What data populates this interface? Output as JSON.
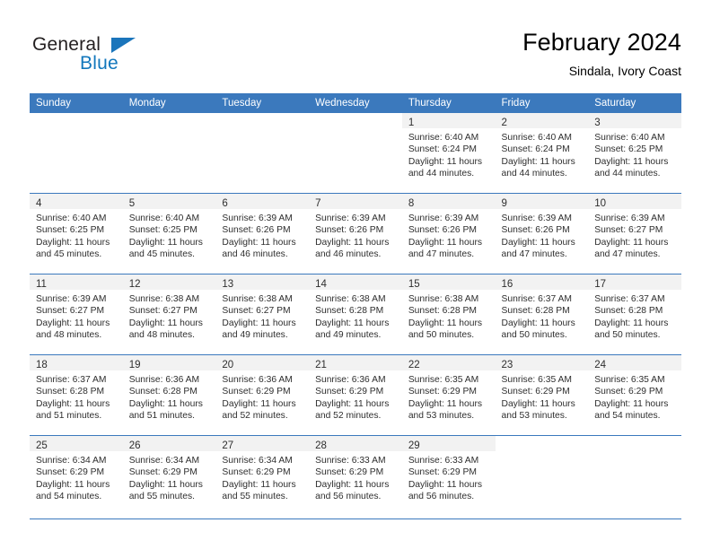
{
  "brand": {
    "name_part1": "General",
    "name_part2": "Blue"
  },
  "header": {
    "title": "February 2024",
    "subtitle": "Sindala, Ivory Coast"
  },
  "weekday_headers": [
    "Sunday",
    "Monday",
    "Tuesday",
    "Wednesday",
    "Thursday",
    "Friday",
    "Saturday"
  ],
  "colors": {
    "header_blue": "#3b79bd",
    "daynum_band": "#f2f2f2",
    "logo_blue": "#1b75bb",
    "text": "#2e2e2e"
  },
  "weeks": [
    [
      {
        "day": "",
        "sunrise": "",
        "sunset": "",
        "daylight_line1": "",
        "daylight_line2": ""
      },
      {
        "day": "",
        "sunrise": "",
        "sunset": "",
        "daylight_line1": "",
        "daylight_line2": ""
      },
      {
        "day": "",
        "sunrise": "",
        "sunset": "",
        "daylight_line1": "",
        "daylight_line2": ""
      },
      {
        "day": "",
        "sunrise": "",
        "sunset": "",
        "daylight_line1": "",
        "daylight_line2": ""
      },
      {
        "day": "1",
        "sunrise": "Sunrise: 6:40 AM",
        "sunset": "Sunset: 6:24 PM",
        "daylight_line1": "Daylight: 11 hours",
        "daylight_line2": "and 44 minutes."
      },
      {
        "day": "2",
        "sunrise": "Sunrise: 6:40 AM",
        "sunset": "Sunset: 6:24 PM",
        "daylight_line1": "Daylight: 11 hours",
        "daylight_line2": "and 44 minutes."
      },
      {
        "day": "3",
        "sunrise": "Sunrise: 6:40 AM",
        "sunset": "Sunset: 6:25 PM",
        "daylight_line1": "Daylight: 11 hours",
        "daylight_line2": "and 44 minutes."
      }
    ],
    [
      {
        "day": "4",
        "sunrise": "Sunrise: 6:40 AM",
        "sunset": "Sunset: 6:25 PM",
        "daylight_line1": "Daylight: 11 hours",
        "daylight_line2": "and 45 minutes."
      },
      {
        "day": "5",
        "sunrise": "Sunrise: 6:40 AM",
        "sunset": "Sunset: 6:25 PM",
        "daylight_line1": "Daylight: 11 hours",
        "daylight_line2": "and 45 minutes."
      },
      {
        "day": "6",
        "sunrise": "Sunrise: 6:39 AM",
        "sunset": "Sunset: 6:26 PM",
        "daylight_line1": "Daylight: 11 hours",
        "daylight_line2": "and 46 minutes."
      },
      {
        "day": "7",
        "sunrise": "Sunrise: 6:39 AM",
        "sunset": "Sunset: 6:26 PM",
        "daylight_line1": "Daylight: 11 hours",
        "daylight_line2": "and 46 minutes."
      },
      {
        "day": "8",
        "sunrise": "Sunrise: 6:39 AM",
        "sunset": "Sunset: 6:26 PM",
        "daylight_line1": "Daylight: 11 hours",
        "daylight_line2": "and 47 minutes."
      },
      {
        "day": "9",
        "sunrise": "Sunrise: 6:39 AM",
        "sunset": "Sunset: 6:26 PM",
        "daylight_line1": "Daylight: 11 hours",
        "daylight_line2": "and 47 minutes."
      },
      {
        "day": "10",
        "sunrise": "Sunrise: 6:39 AM",
        "sunset": "Sunset: 6:27 PM",
        "daylight_line1": "Daylight: 11 hours",
        "daylight_line2": "and 47 minutes."
      }
    ],
    [
      {
        "day": "11",
        "sunrise": "Sunrise: 6:39 AM",
        "sunset": "Sunset: 6:27 PM",
        "daylight_line1": "Daylight: 11 hours",
        "daylight_line2": "and 48 minutes."
      },
      {
        "day": "12",
        "sunrise": "Sunrise: 6:38 AM",
        "sunset": "Sunset: 6:27 PM",
        "daylight_line1": "Daylight: 11 hours",
        "daylight_line2": "and 48 minutes."
      },
      {
        "day": "13",
        "sunrise": "Sunrise: 6:38 AM",
        "sunset": "Sunset: 6:27 PM",
        "daylight_line1": "Daylight: 11 hours",
        "daylight_line2": "and 49 minutes."
      },
      {
        "day": "14",
        "sunrise": "Sunrise: 6:38 AM",
        "sunset": "Sunset: 6:28 PM",
        "daylight_line1": "Daylight: 11 hours",
        "daylight_line2": "and 49 minutes."
      },
      {
        "day": "15",
        "sunrise": "Sunrise: 6:38 AM",
        "sunset": "Sunset: 6:28 PM",
        "daylight_line1": "Daylight: 11 hours",
        "daylight_line2": "and 50 minutes."
      },
      {
        "day": "16",
        "sunrise": "Sunrise: 6:37 AM",
        "sunset": "Sunset: 6:28 PM",
        "daylight_line1": "Daylight: 11 hours",
        "daylight_line2": "and 50 minutes."
      },
      {
        "day": "17",
        "sunrise": "Sunrise: 6:37 AM",
        "sunset": "Sunset: 6:28 PM",
        "daylight_line1": "Daylight: 11 hours",
        "daylight_line2": "and 50 minutes."
      }
    ],
    [
      {
        "day": "18",
        "sunrise": "Sunrise: 6:37 AM",
        "sunset": "Sunset: 6:28 PM",
        "daylight_line1": "Daylight: 11 hours",
        "daylight_line2": "and 51 minutes."
      },
      {
        "day": "19",
        "sunrise": "Sunrise: 6:36 AM",
        "sunset": "Sunset: 6:28 PM",
        "daylight_line1": "Daylight: 11 hours",
        "daylight_line2": "and 51 minutes."
      },
      {
        "day": "20",
        "sunrise": "Sunrise: 6:36 AM",
        "sunset": "Sunset: 6:29 PM",
        "daylight_line1": "Daylight: 11 hours",
        "daylight_line2": "and 52 minutes."
      },
      {
        "day": "21",
        "sunrise": "Sunrise: 6:36 AM",
        "sunset": "Sunset: 6:29 PM",
        "daylight_line1": "Daylight: 11 hours",
        "daylight_line2": "and 52 minutes."
      },
      {
        "day": "22",
        "sunrise": "Sunrise: 6:35 AM",
        "sunset": "Sunset: 6:29 PM",
        "daylight_line1": "Daylight: 11 hours",
        "daylight_line2": "and 53 minutes."
      },
      {
        "day": "23",
        "sunrise": "Sunrise: 6:35 AM",
        "sunset": "Sunset: 6:29 PM",
        "daylight_line1": "Daylight: 11 hours",
        "daylight_line2": "and 53 minutes."
      },
      {
        "day": "24",
        "sunrise": "Sunrise: 6:35 AM",
        "sunset": "Sunset: 6:29 PM",
        "daylight_line1": "Daylight: 11 hours",
        "daylight_line2": "and 54 minutes."
      }
    ],
    [
      {
        "day": "25",
        "sunrise": "Sunrise: 6:34 AM",
        "sunset": "Sunset: 6:29 PM",
        "daylight_line1": "Daylight: 11 hours",
        "daylight_line2": "and 54 minutes."
      },
      {
        "day": "26",
        "sunrise": "Sunrise: 6:34 AM",
        "sunset": "Sunset: 6:29 PM",
        "daylight_line1": "Daylight: 11 hours",
        "daylight_line2": "and 55 minutes."
      },
      {
        "day": "27",
        "sunrise": "Sunrise: 6:34 AM",
        "sunset": "Sunset: 6:29 PM",
        "daylight_line1": "Daylight: 11 hours",
        "daylight_line2": "and 55 minutes."
      },
      {
        "day": "28",
        "sunrise": "Sunrise: 6:33 AM",
        "sunset": "Sunset: 6:29 PM",
        "daylight_line1": "Daylight: 11 hours",
        "daylight_line2": "and 56 minutes."
      },
      {
        "day": "29",
        "sunrise": "Sunrise: 6:33 AM",
        "sunset": "Sunset: 6:29 PM",
        "daylight_line1": "Daylight: 11 hours",
        "daylight_line2": "and 56 minutes."
      },
      {
        "day": "",
        "sunrise": "",
        "sunset": "",
        "daylight_line1": "",
        "daylight_line2": ""
      },
      {
        "day": "",
        "sunrise": "",
        "sunset": "",
        "daylight_line1": "",
        "daylight_line2": ""
      }
    ]
  ]
}
